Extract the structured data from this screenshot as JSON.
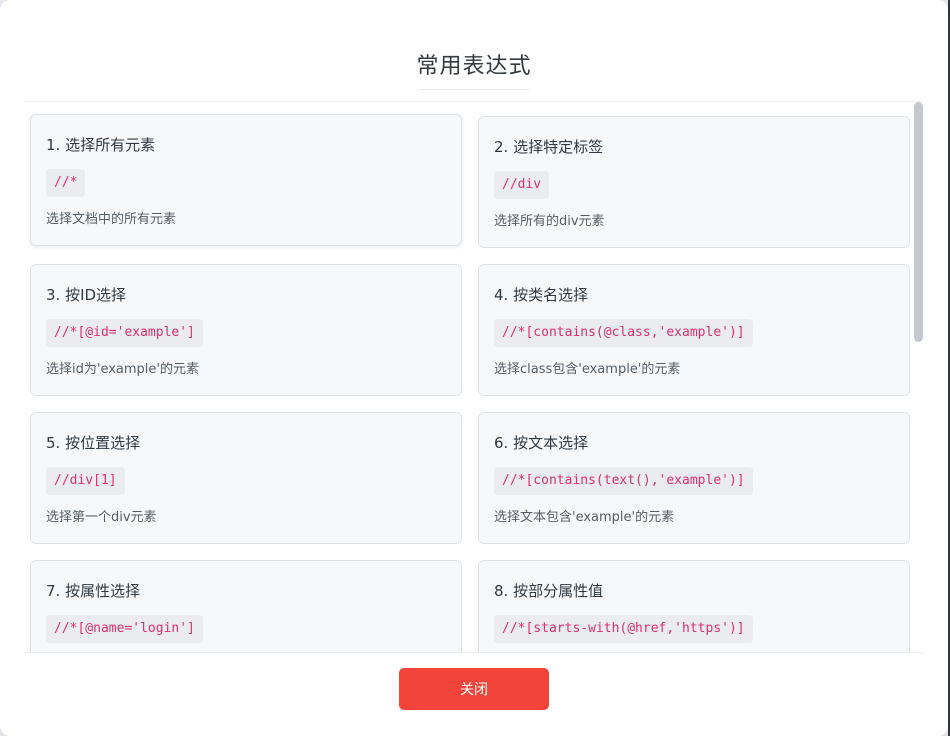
{
  "dialog": {
    "title": "常用表达式",
    "close_label": "关闭"
  },
  "expressions": [
    {
      "title": "1. 选择所有元素",
      "code": "//*",
      "desc": "选择文档中的所有元素"
    },
    {
      "title": "2. 选择特定标签",
      "code": "//div",
      "desc": "选择所有的div元素"
    },
    {
      "title": "3. 按ID选择",
      "code": "//*[@id='example']",
      "desc": "选择id为'example'的元素"
    },
    {
      "title": "4. 按类名选择",
      "code": "//*[contains(@class,'example')]",
      "desc": "选择class包含'example'的元素"
    },
    {
      "title": "5. 按位置选择",
      "code": "//div[1]",
      "desc": "选择第一个div元素"
    },
    {
      "title": "6. 按文本选择",
      "code": "//*[contains(text(),'example')]",
      "desc": "选择文本包含'example'的元素"
    },
    {
      "title": "7. 按属性选择",
      "code": "//*[@name='login']",
      "desc": ""
    },
    {
      "title": "8. 按部分属性值",
      "code": "//*[starts-with(@href,'https')]",
      "desc": ""
    }
  ]
}
